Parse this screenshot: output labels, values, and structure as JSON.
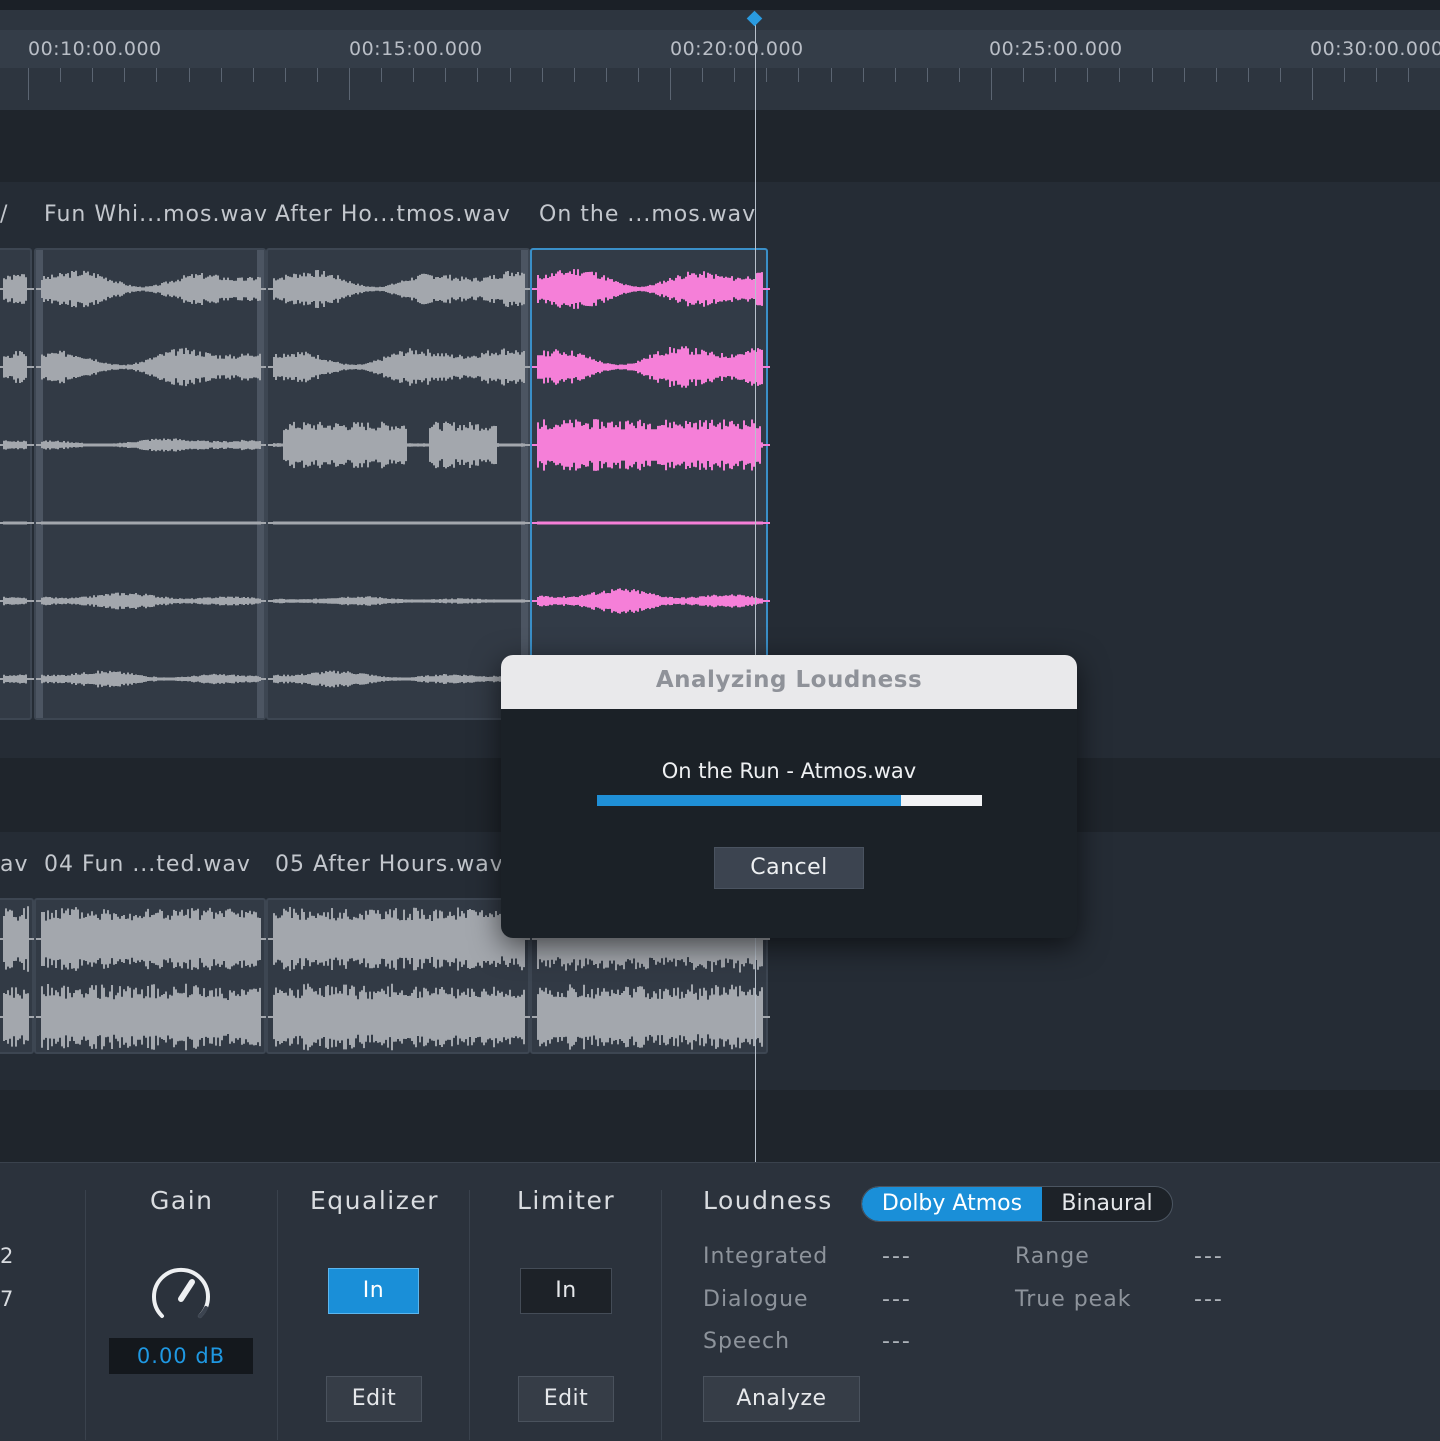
{
  "ruler": {
    "labels": [
      "00:10:00.000",
      "00:15:00.000",
      "00:20:00.000",
      "00:25:00.000",
      "00:30:00.000"
    ]
  },
  "track1": {
    "clips": [
      {
        "title": "/"
      },
      {
        "title": "Fun Whi...mos.wav"
      },
      {
        "title": "After Ho...tmos.wav"
      },
      {
        "title": "On the ...mos.wav"
      }
    ]
  },
  "track2": {
    "clips": [
      {
        "title": "av"
      },
      {
        "title": "04 Fun ...ted.wav"
      },
      {
        "title": "05 After Hours.wav"
      }
    ]
  },
  "dialog": {
    "title": "Analyzing Loudness",
    "file": "On the Run - Atmos.wav",
    "progress_percent": 79,
    "cancel_label": "Cancel"
  },
  "panel": {
    "edge_values": [
      "2",
      "7"
    ],
    "gain": {
      "title": "Gain",
      "value": "0.00 dB"
    },
    "equalizer": {
      "title": "Equalizer",
      "in_label": "In",
      "edit_label": "Edit"
    },
    "limiter": {
      "title": "Limiter",
      "in_label": "In",
      "edit_label": "Edit"
    },
    "loudness": {
      "title": "Loudness",
      "mode_a": "Dolby Atmos",
      "mode_b": "Binaural",
      "integrated_label": "Integrated",
      "integrated_value": "---",
      "dialogue_label": "Dialogue",
      "dialogue_value": "---",
      "speech_label": "Speech",
      "speech_value": "---",
      "range_label": "Range",
      "range_value": "---",
      "truepeak_label": "True peak",
      "truepeak_value": "---",
      "analyze_label": "Analyze"
    }
  },
  "colors": {
    "accent": "#1a8fd8",
    "selected_wave": "#f57fd8",
    "wave": "#a3a7ad"
  }
}
